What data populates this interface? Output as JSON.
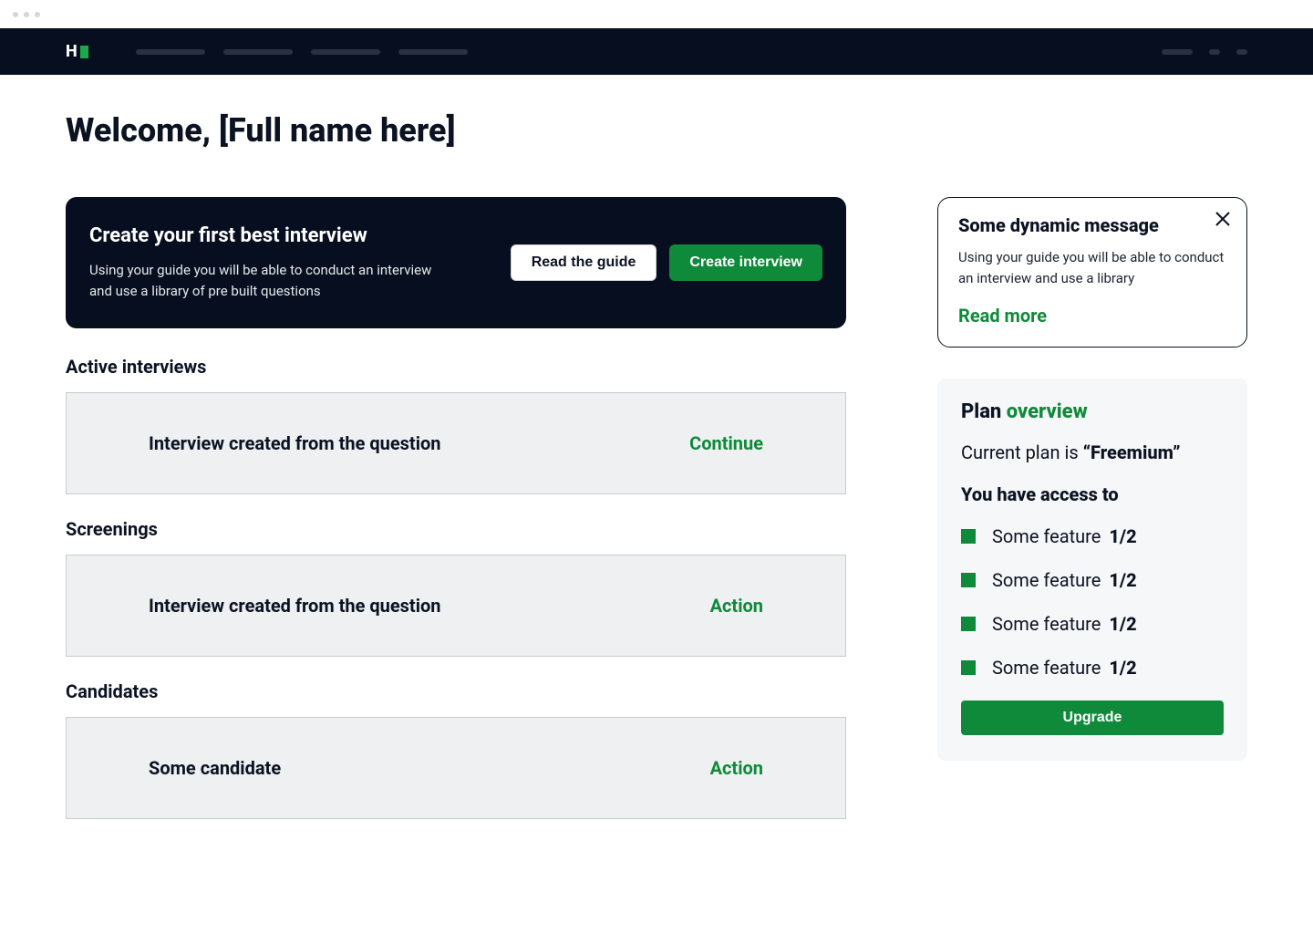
{
  "greeting": "Welcome, [Full name here]",
  "hero": {
    "title": "Create your first best interview",
    "subtitle": "Using your guide you will be able to conduct an interview and use a library of pre built questions",
    "read_guide_label": "Read the guide",
    "create_label": "Create interview"
  },
  "sections": {
    "active_interviews": {
      "heading": "Active interviews",
      "items": [
        {
          "title": "Interview created from the question",
          "action": "Continue"
        }
      ]
    },
    "screenings": {
      "heading": "Screenings",
      "items": [
        {
          "title": "Interview created from the question",
          "action": "Action"
        }
      ]
    },
    "candidates": {
      "heading": "Candidates",
      "items": [
        {
          "title": "Some candidate",
          "action": "Action"
        }
      ]
    }
  },
  "message_card": {
    "title": "Some dynamic message",
    "body": "Using your guide you will be able to conduct an interview and use a library",
    "read_more_label": "Read more"
  },
  "plan": {
    "heading_prefix": "Plan ",
    "heading_accent": "overview",
    "current_prefix": "Current plan is ",
    "current_name": "“Freemium”",
    "access_label": "You have access to",
    "features": [
      {
        "text": "Some feature ",
        "count": "1/2"
      },
      {
        "text": "Some feature ",
        "count": "1/2"
      },
      {
        "text": "Some feature ",
        "count": "1/2"
      },
      {
        "text": "Some feature ",
        "count": "1/2"
      }
    ],
    "upgrade_label": "Upgrade"
  }
}
